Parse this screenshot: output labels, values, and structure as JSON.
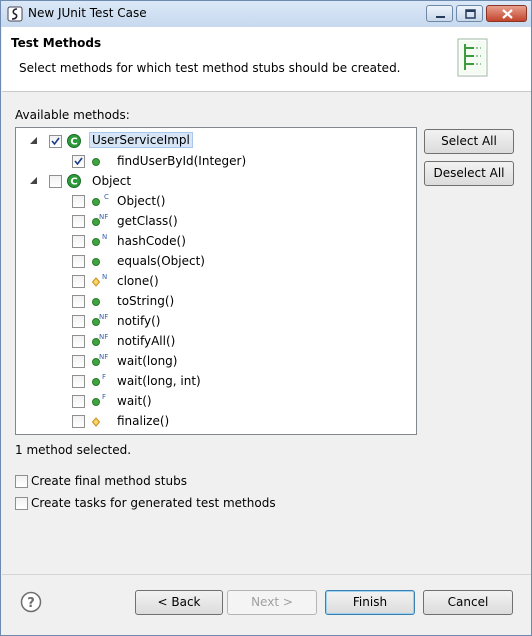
{
  "window": {
    "title": "New JUnit Test Case"
  },
  "banner": {
    "title": "Test Methods",
    "description": "Select methods for which test method stubs should be created."
  },
  "tree": {
    "label": "Available methods:",
    "rows": [
      {
        "label": "UserServiceImpl",
        "checked": true,
        "icon": "class-icon"
      },
      {
        "label": "findUserById(Integer)",
        "checked": true,
        "icon": "public-method-icon"
      },
      {
        "label": "Object",
        "checked": false,
        "icon": "class-icon"
      },
      {
        "label": "Object()",
        "checked": false,
        "icon": "constructor-icon",
        "badge": "C"
      },
      {
        "label": "getClass()",
        "checked": false,
        "icon": "public-method-icon",
        "badge": "NF"
      },
      {
        "label": "hashCode()",
        "checked": false,
        "icon": "public-method-icon",
        "badge": "N"
      },
      {
        "label": "equals(Object)",
        "checked": false,
        "icon": "public-method-icon",
        "badge": ""
      },
      {
        "label": "clone()",
        "checked": false,
        "icon": "protected-method-icon",
        "badge": "N"
      },
      {
        "label": "toString()",
        "checked": false,
        "icon": "public-method-icon",
        "badge": ""
      },
      {
        "label": "notify()",
        "checked": false,
        "icon": "public-method-icon",
        "badge": "NF"
      },
      {
        "label": "notifyAll()",
        "checked": false,
        "icon": "public-method-icon",
        "badge": "NF"
      },
      {
        "label": "wait(long)",
        "checked": false,
        "icon": "public-method-icon",
        "badge": "NF"
      },
      {
        "label": "wait(long, int)",
        "checked": false,
        "icon": "public-method-icon",
        "badge": "F"
      },
      {
        "label": "wait()",
        "checked": false,
        "icon": "public-method-icon",
        "badge": "F"
      },
      {
        "label": "finalize()",
        "checked": false,
        "icon": "protected-method-icon",
        "badge": ""
      }
    ]
  },
  "side_buttons": {
    "select_all": "Select All",
    "deselect_all": "Deselect All"
  },
  "status": "1 method selected.",
  "options": {
    "final_stubs": {
      "label": "Create final method stubs",
      "checked": false
    },
    "tasks": {
      "label": "Create tasks for generated test methods",
      "checked": false
    }
  },
  "footer": {
    "back": "< Back",
    "next": "Next >",
    "finish": "Finish",
    "cancel": "Cancel"
  },
  "colors": {
    "method_green": "#3fa33f",
    "protected_yellow": "#e9b73a",
    "class_green": "#2e9b3b",
    "badge_blue": "#3a5fa8"
  }
}
